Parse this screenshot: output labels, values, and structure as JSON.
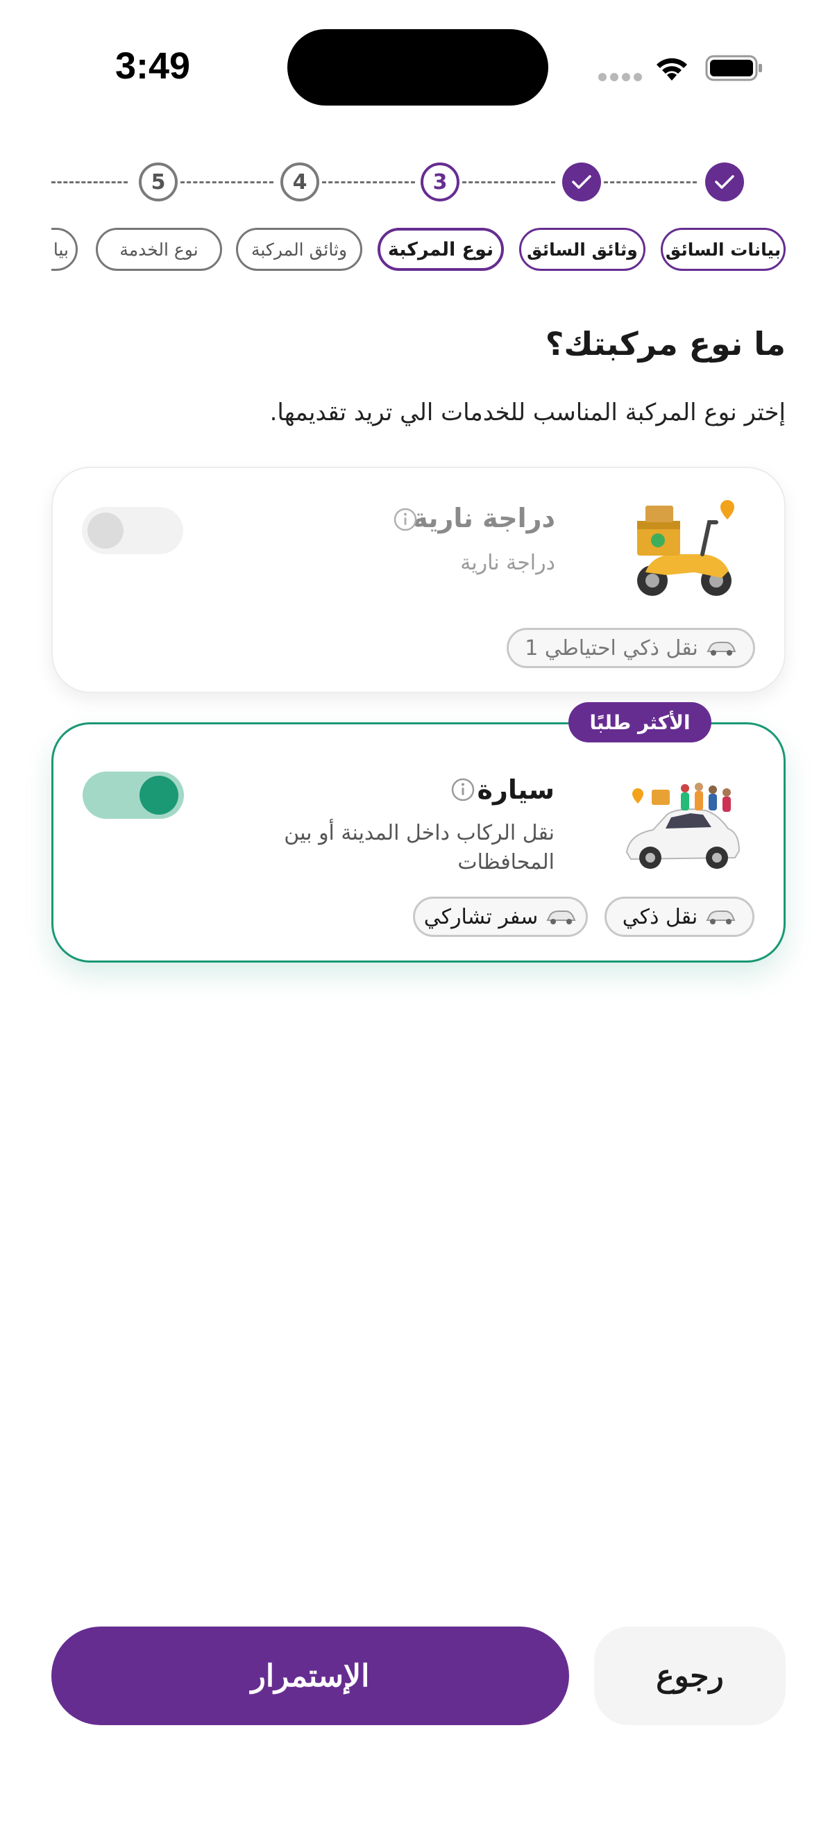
{
  "status_bar": {
    "time": "3:49"
  },
  "stepper": {
    "steps": [
      {
        "label": "✓",
        "state": "done"
      },
      {
        "label": "✓",
        "state": "done"
      },
      {
        "label": "3",
        "state": "current"
      },
      {
        "label": "4",
        "state": "todo"
      },
      {
        "label": "5",
        "state": "todo"
      }
    ],
    "labels": [
      "بيانات السائق",
      "وثائق السائق",
      "نوع المركبة",
      "وثائق المركبة",
      "نوع الخدمة",
      "بيا"
    ]
  },
  "page": {
    "title": "ما نوع مركبتك؟",
    "subtitle": "إختر نوع المركبة المناسب للخدمات الي تريد تقديمها."
  },
  "vehicles": [
    {
      "title": "دراجة نارية",
      "description": "دراجة نارية",
      "enabled": false,
      "chips": [
        "نقل ذكي احتياطي 1"
      ]
    },
    {
      "title": "سيارة",
      "description": "نقل الركاب داخل المدينة أو بين المحافظات",
      "enabled": true,
      "badge": "الأكثر طلبًا",
      "chips": [
        "نقل ذكي",
        "سفر تشاركي"
      ]
    }
  ],
  "buttons": {
    "continue": "الإستمرار",
    "back": "رجوع"
  },
  "colors": {
    "primary": "#662d91",
    "success": "#1b9874",
    "success_light": "#a3d8c7"
  }
}
